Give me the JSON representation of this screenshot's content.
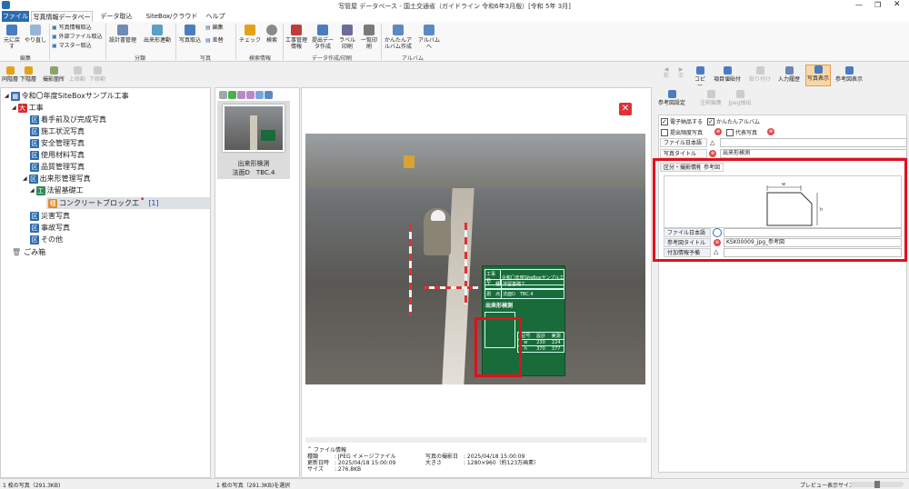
{
  "window": {
    "title": "写管屋 データベース - 国土交通省（ガイドライン 令和6年3月版）[令和 5年 3月]"
  },
  "tabs": [
    "ファイル",
    "写真情報データベース",
    "データ取込",
    "SiteBox/クラウド",
    "ヘルプ"
  ],
  "ribbon": {
    "edit": {
      "undo": "元に戻す",
      "redo": "やり直し",
      "group": "編集"
    },
    "import": {
      "photo_info": "写真情報取込",
      "external": "外部ファイル取込",
      "master": "マスター取込"
    },
    "classify": {
      "design": "設計書管理",
      "dekigata": "出来形連動",
      "group": "分類"
    },
    "photo": {
      "take": "写真取込",
      "edit": "編集",
      "replace": "差替",
      "group": "写真"
    },
    "search": {
      "check": "チェック",
      "search": "検索",
      "group": "検索情報"
    },
    "create": {
      "koji": "工事管理情報",
      "teishutsu": "提出データ作成",
      "label": "ラベル印刷",
      "list": "一覧印刷",
      "group": "データ作成/印刷"
    },
    "album": {
      "easy": "かんたんアルバム作成",
      "album": "アルバムへ",
      "group": "アルバム"
    }
  },
  "toolbar2": [
    "同階層",
    "下階層",
    "撮影箇所",
    "上移動",
    "下移動"
  ],
  "tree": {
    "root": "令和〇年度SiteBoxサンプル工事",
    "kouji": "工事",
    "items": [
      "着手前及び完成写真",
      "施工状況写真",
      "安全管理写真",
      "使用材料写真",
      "品質管理写真",
      "出来形管理写真"
    ],
    "sub": "法留基礎工",
    "leaf": "コンクリートブロック工",
    "leaf_count": "[1]",
    "after": [
      "災害写真",
      "事故写真",
      "その他"
    ],
    "trash": "ごみ箱"
  },
  "thumb": {
    "caption1": "出来形検測",
    "caption2": "法面D　TBC.4"
  },
  "fileinfo": {
    "header": "ファイル情報",
    "type_label": "種類",
    "type_value": ": JPEG イメージファイル",
    "updated_label": "更新日時",
    "updated_value": ": 2025/04/18 15:00:09",
    "size_label": "サイズ",
    "size_value": ": 276.8KB",
    "shot_label": "写真の撮影日",
    "shot_value": ": 2025/04/18 15:00:09",
    "dim_label": "大きさ",
    "dim_value": ": 1280×960（約123万画素）"
  },
  "board": {
    "r1k": "工事名",
    "r1v": "令和〇年度SiteBoxサンプル工事",
    "r2k": "工　種",
    "r2v": "法留基礎工",
    "r3k": "測　点",
    "r3v": "法面D　TBC.4",
    "title": "出来形検測",
    "th": [
      "記号",
      "設計",
      "実測"
    ],
    "rows": [
      [
        "w",
        "230",
        "224"
      ],
      [
        "h",
        "370",
        "377"
      ]
    ]
  },
  "right": {
    "nav": [
      "前",
      "次",
      "コピー",
      "項目値貼付",
      "貼り付け",
      "入力履歴",
      "写真表示",
      "参考図表示"
    ],
    "ref": [
      "参考図設定",
      "注釈編集",
      "Jpeg抽出"
    ],
    "chk": {
      "a": "電子納品する",
      "b": "かんたんアルバム",
      "c": "提出頻度写真",
      "d": "代表写真"
    },
    "f1": "ファイル日本語名",
    "f2": "写真タイトル",
    "f2v": "出来形検測",
    "tabs": [
      "区分・撮影情報",
      "参考図"
    ],
    "t1": "ファイル日本語名",
    "t2": "参考図タイトル",
    "t2v": "KSK00009_jpg_参考図",
    "t3": "付加情報予備"
  },
  "status": {
    "left": "1 枚の写真（291.3KB)",
    "mid": "1 枚の写真（291.3KB)を選択",
    "right": "プレビュー表示サイズ"
  },
  "colors": {
    "accent": "#2b6cb0",
    "red": "#e0101e",
    "board": "#1a6b3a"
  }
}
